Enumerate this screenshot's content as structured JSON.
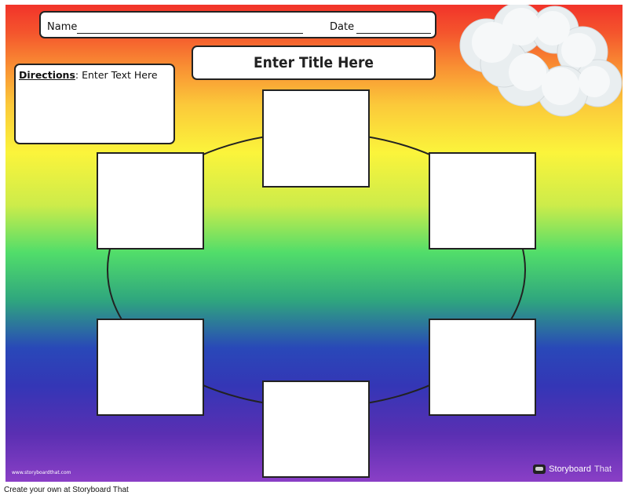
{
  "worksheet": {
    "name_label": "Name",
    "date_label": "Date",
    "title": "Enter Title Here",
    "directions_label": "Directions",
    "directions_text": ": Enter Text Here",
    "frames": [
      "",
      "",
      "",
      "",
      "",
      ""
    ],
    "colors": {
      "top": "#f2332a",
      "middle": "#51dd6a",
      "bottom": "#8a3fc6",
      "frame_border": "#222222"
    }
  },
  "footer": {
    "website": "www.storyboardthat.com",
    "logo_text_bold": "Storyboard",
    "logo_text_light": "That",
    "caption": "Create your own at Storyboard That"
  }
}
